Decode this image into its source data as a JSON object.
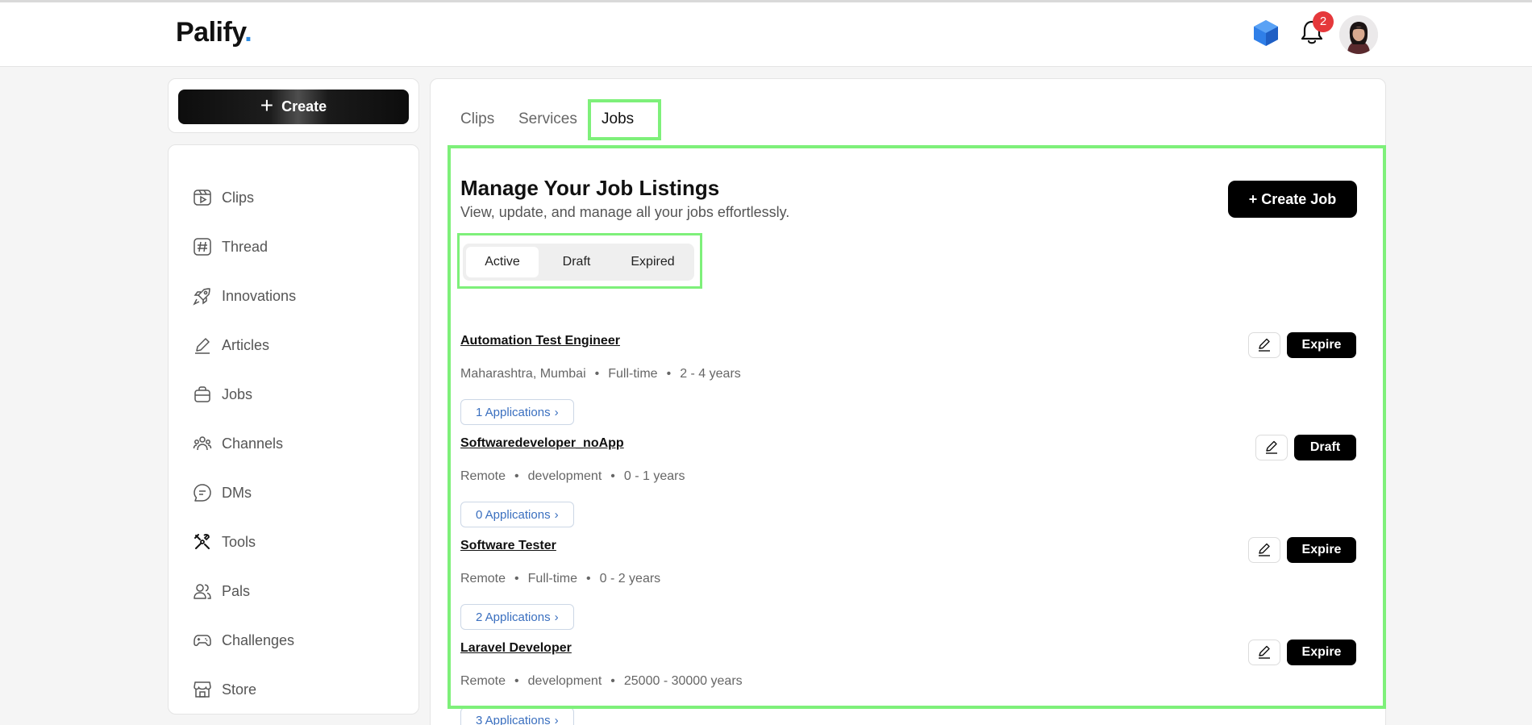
{
  "header": {
    "logo_text": "Palify",
    "logo_dot": ".",
    "notification_count": "2",
    "accent_color": "#2f8de4",
    "badge_color": "#e5383b"
  },
  "sidebar": {
    "create_label": "Create",
    "items": [
      {
        "label": "Clips",
        "icon": "clips-icon"
      },
      {
        "label": "Thread",
        "icon": "hash-icon"
      },
      {
        "label": "Innovations",
        "icon": "rocket-icon"
      },
      {
        "label": "Articles",
        "icon": "pen-icon"
      },
      {
        "label": "Jobs",
        "icon": "briefcase-icon"
      },
      {
        "label": "Channels",
        "icon": "channels-icon"
      },
      {
        "label": "DMs",
        "icon": "chat-icon"
      },
      {
        "label": "Tools",
        "icon": "tools-icon"
      },
      {
        "label": "Pals",
        "icon": "users-icon"
      },
      {
        "label": "Challenges",
        "icon": "gamepad-icon"
      },
      {
        "label": "Store",
        "icon": "store-icon"
      }
    ]
  },
  "tabs": [
    {
      "label": "Clips"
    },
    {
      "label": "Services"
    },
    {
      "label": "Jobs",
      "active": true
    }
  ],
  "jobs_panel": {
    "title": "Manage Your Job Listings",
    "subtitle": "View, update, and manage all your jobs effortlessly.",
    "create_job_label": "+ Create Job",
    "filters": [
      {
        "label": "Active",
        "active": true
      },
      {
        "label": "Draft"
      },
      {
        "label": "Expired"
      }
    ],
    "jobs": [
      {
        "title": "Automation Test Engineer",
        "location": "Maharashtra, Mumbai",
        "type": "Full-time",
        "experience": "2 - 4 years",
        "applications": "1 Applications",
        "action": "Expire"
      },
      {
        "title": "Softwaredeveloper_noApp",
        "location": "Remote",
        "type": "development",
        "experience": "0 - 1 years",
        "applications": "0 Applications",
        "action": "Draft"
      },
      {
        "title": "Software Tester",
        "location": "Remote",
        "type": "Full-time",
        "experience": "0 - 2 years",
        "applications": "2 Applications",
        "action": "Expire"
      },
      {
        "title": "Laravel Developer",
        "location": "Remote",
        "type": "development",
        "experience": "25000 - 30000 years",
        "applications": "3 Applications",
        "action": "Expire"
      }
    ]
  }
}
